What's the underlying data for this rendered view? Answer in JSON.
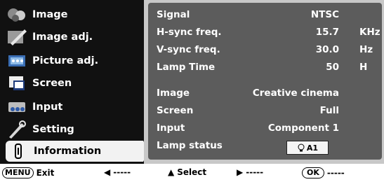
{
  "menu": {
    "items": [
      {
        "label": "Image",
        "icon": "image-icon"
      },
      {
        "label": "Image adj.",
        "icon": "image-adj-icon"
      },
      {
        "label": "Picture adj.",
        "icon": "picture-adj-icon"
      },
      {
        "label": "Screen",
        "icon": "screen-icon"
      },
      {
        "label": "Input",
        "icon": "input-icon"
      },
      {
        "label": "Setting",
        "icon": "setting-icon"
      },
      {
        "label": "Information",
        "icon": "information-icon"
      }
    ],
    "active": "Information"
  },
  "info": {
    "signal": {
      "label": "Signal",
      "value": "NTSC"
    },
    "hsync": {
      "label": "H-sync freq.",
      "value": "15.7",
      "unit": "KHz"
    },
    "vsync": {
      "label": "V-sync freq.",
      "value": "30.0",
      "unit": "Hz"
    },
    "lamp_time": {
      "label": "Lamp Time",
      "value": "50",
      "unit": "H"
    },
    "image": {
      "label": "Image",
      "value": "Creative cinema"
    },
    "screen": {
      "label": "Screen",
      "value": "Full"
    },
    "input": {
      "label": "Input",
      "value": "Component 1"
    },
    "lamp_status": {
      "label": "Lamp status",
      "value": "A1"
    }
  },
  "footer": {
    "menu_btn": "MENU",
    "exit": "Exit",
    "left_dashes": "-----",
    "select": "Select",
    "right_dashes": "-----",
    "ok_btn": "OK",
    "ok_dashes": "-----"
  }
}
